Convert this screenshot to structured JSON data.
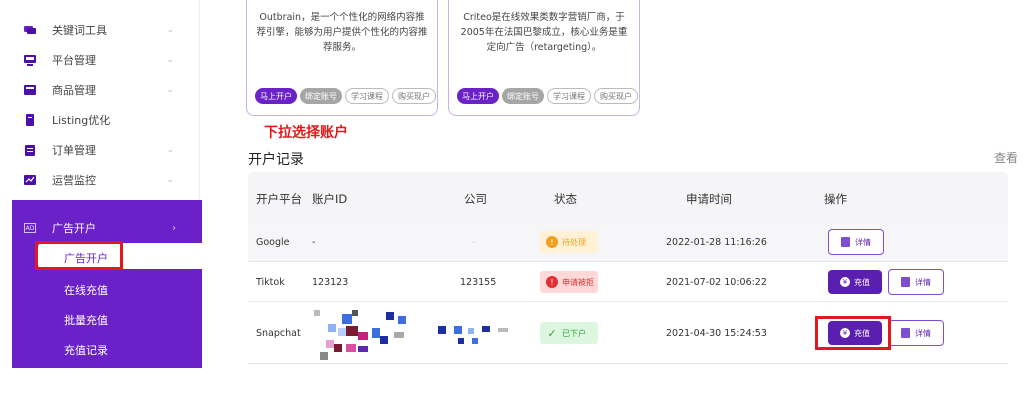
{
  "sidebar": {
    "items": [
      {
        "label": "关键词工具",
        "icon": "chat-icon"
      },
      {
        "label": "平台管理",
        "icon": "monitor-icon"
      },
      {
        "label": "商品管理",
        "icon": "box-icon"
      },
      {
        "label": "Listing优化",
        "icon": "doc-icon"
      },
      {
        "label": "订单管理",
        "icon": "clipboard-icon"
      },
      {
        "label": "运营监控",
        "icon": "chart-icon"
      }
    ],
    "ad_section": {
      "label": "广告开户",
      "badge": "AD",
      "active_sub": "广告开户",
      "sub_items": [
        "在线充值",
        "批量充值",
        "充值记录"
      ]
    }
  },
  "cards": [
    {
      "description": "Outbrain，是一个个性化的网络内容推荐引擎，能够为用户提供个性化的内容推荐服务。",
      "buttons": {
        "open": "马上开户",
        "bind": "绑定账号",
        "course": "学习课程",
        "buy": "购买现户"
      }
    },
    {
      "description": "Criteo是在线效果类数字营销厂商，于2005年在法国巴黎成立，核心业务是重定向广告（retargeting）。",
      "buttons": {
        "open": "马上开户",
        "bind": "绑定账号",
        "course": "学习课程",
        "buy": "购买现户"
      }
    }
  ],
  "annotation_note": "下拉选择账户",
  "section_title": "开户记录",
  "right_cut_text": "查看",
  "table": {
    "headers": {
      "platform": "开户平台",
      "account_id": "账户ID",
      "company": "公司",
      "status": "状态",
      "apply_time": "申请时间",
      "action": "操作"
    },
    "rows": [
      {
        "platform": "Google",
        "account_id": "-",
        "company": "-",
        "status": "待处理",
        "status_type": "pending",
        "apply_time": "2022-01-28 11:16:26",
        "actions": {
          "detail": "详情"
        }
      },
      {
        "platform": "Tiktok",
        "account_id": "123123",
        "company": "123155",
        "status": "申请被拒",
        "status_type": "rejected",
        "apply_time": "2021-07-02 10:06:22",
        "actions": {
          "recharge": "充值",
          "detail": "详情"
        }
      },
      {
        "platform": "Snapchat",
        "account_id": "",
        "company": "",
        "status": "已下户",
        "status_type": "done",
        "apply_time": "2021-04-30 15:24:53",
        "actions": {
          "recharge": "充值",
          "detail": "详情"
        }
      }
    ]
  },
  "colors": {
    "brand_purple": "#6a22c8",
    "annotation_red": "#e11919"
  }
}
